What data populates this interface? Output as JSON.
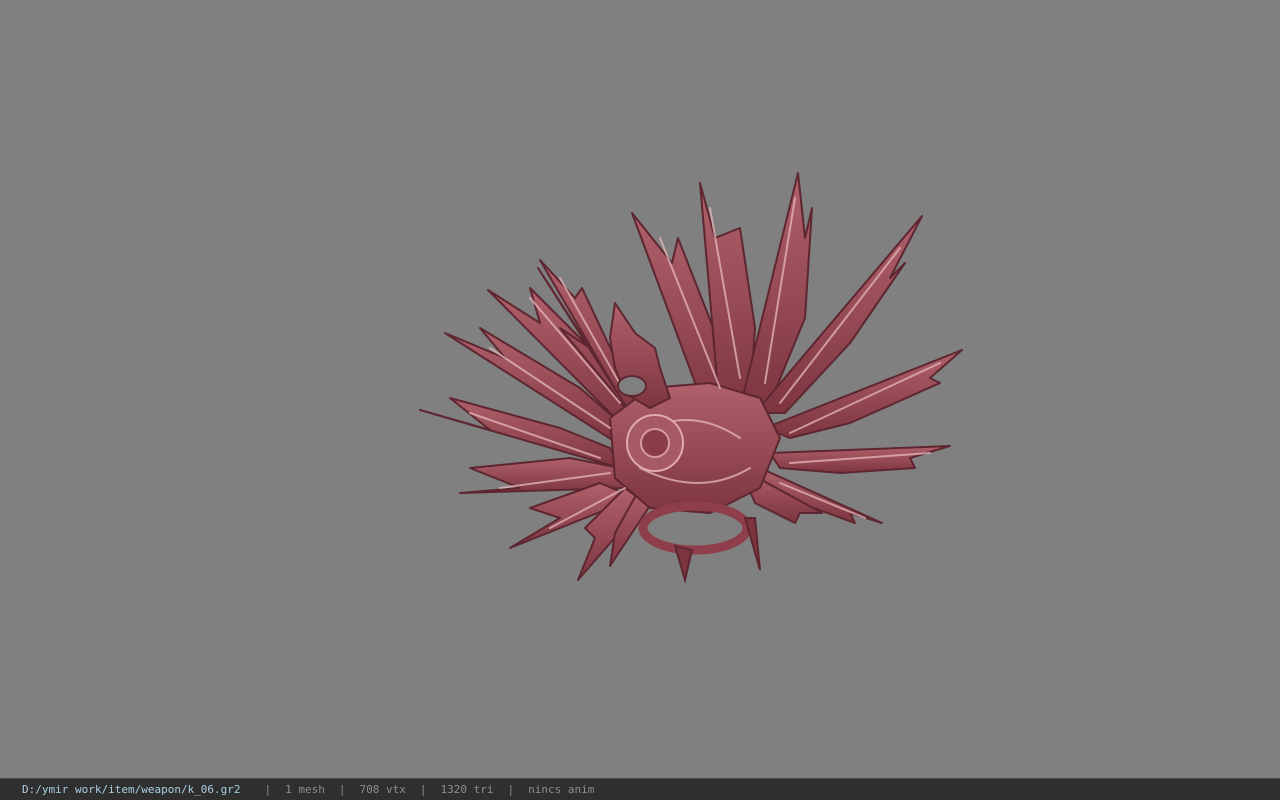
{
  "viewport": {
    "background_color": "#808080",
    "model": {
      "name": "crimson leaf-shaped fan weapon",
      "color_main": "#9b4a55",
      "color_dark": "#5e2630",
      "color_highlight": "#e6b8bd"
    }
  },
  "status_bar": {
    "file_path": "D:/ymir work/item/weapon/k_06.gr2",
    "separator": "|",
    "mesh_count": "1 mesh",
    "vertex_count": "708 vtx",
    "triangle_count": "1320 tri",
    "animation": "nincs anim"
  }
}
